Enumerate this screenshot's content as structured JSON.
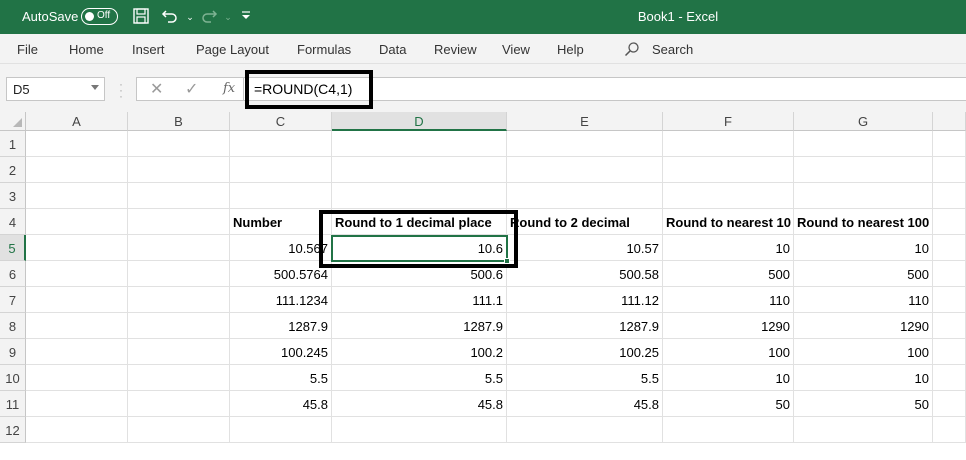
{
  "titlebar": {
    "autosave_label": "AutoSave",
    "autosave_state": "Off",
    "title": "Book1  -  Excel"
  },
  "menu": [
    "File",
    "Home",
    "Insert",
    "Page Layout",
    "Formulas",
    "Data",
    "Review",
    "View",
    "Help"
  ],
  "search": {
    "label": "Search"
  },
  "formula_bar": {
    "name_box": "D5",
    "fx_label": "fx",
    "formula": "=ROUND(C4,1)"
  },
  "columns": [
    "A",
    "B",
    "C",
    "D",
    "E",
    "F",
    "G"
  ],
  "rows": [
    "1",
    "2",
    "3",
    "4",
    "5",
    "6",
    "7",
    "8",
    "9",
    "10",
    "11",
    "12"
  ],
  "table": {
    "headers": [
      "Number",
      "Round to 1 decimal place",
      "Round to 2 decimal",
      "Round to nearest 10",
      "Round to nearest 100"
    ],
    "rows": [
      [
        "10.567",
        "10.6",
        "10.57",
        "10",
        "10"
      ],
      [
        "500.5764",
        "500.6",
        "500.58",
        "500",
        "500"
      ],
      [
        "111.1234",
        "111.1",
        "111.12",
        "110",
        "110"
      ],
      [
        "1287.9",
        "1287.9",
        "1287.9",
        "1290",
        "1290"
      ],
      [
        "100.245",
        "100.2",
        "100.25",
        "100",
        "100"
      ],
      [
        "5.5",
        "5.5",
        "5.5",
        "10",
        "10"
      ],
      [
        "45.8",
        "45.8",
        "45.8",
        "50",
        "50"
      ]
    ]
  },
  "colors": {
    "accent": "#217346"
  }
}
